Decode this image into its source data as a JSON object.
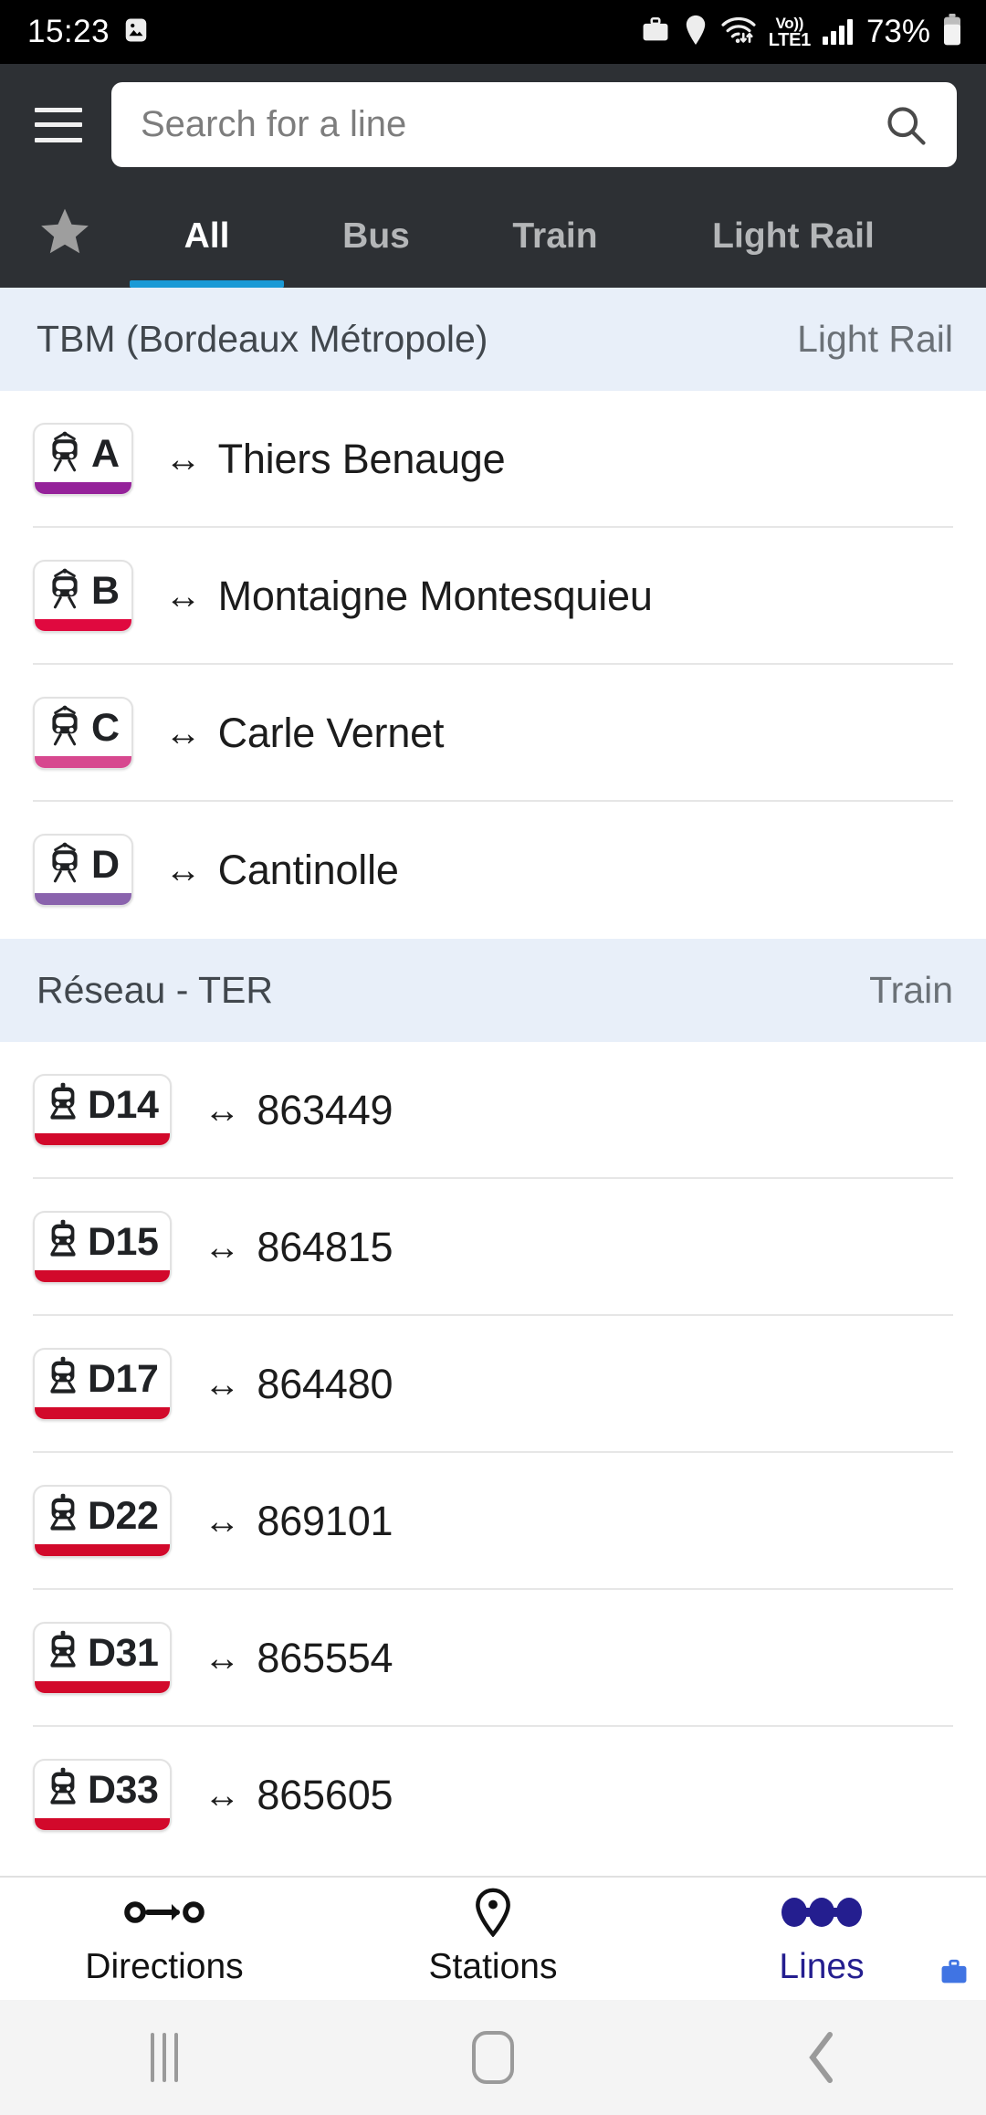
{
  "statusbar": {
    "time": "15:23",
    "icons_left": [
      "photo-icon"
    ],
    "icons_right": [
      "work-briefcase-icon",
      "location-pin-icon",
      "wifi-icon",
      "volte-icon",
      "signal-bars-icon"
    ],
    "volte_top": "Vo))",
    "volte_bottom": "LTE1",
    "battery": "73%"
  },
  "appbar": {
    "menu_icon": "hamburger-menu-icon",
    "search": {
      "placeholder": "Search for a line",
      "value": "",
      "icon": "search-icon"
    },
    "tabs": [
      {
        "label": "",
        "icon": "star-icon",
        "active": false
      },
      {
        "label": "All",
        "active": true
      },
      {
        "label": "Bus",
        "active": false
      },
      {
        "label": "Train",
        "active": false
      },
      {
        "label": "Light Rail",
        "active": false
      }
    ],
    "active_tab_color": "#1b9ad6"
  },
  "groups": [
    {
      "name": "TBM (Bordeaux Métropole)",
      "mode": "Light Rail",
      "rows": [
        {
          "code": "A",
          "icon": "tram-icon",
          "color": "#95229a",
          "arrow": "↔",
          "destination": "Thiers Benauge"
        },
        {
          "code": "B",
          "icon": "tram-icon",
          "color": "#e0093f",
          "arrow": "↔",
          "destination": "Montaigne Montesquieu"
        },
        {
          "code": "C",
          "icon": "tram-icon",
          "color": "#d7488f",
          "arrow": "↔",
          "destination": "Carle Vernet"
        },
        {
          "code": "D",
          "icon": "tram-icon",
          "color": "#8a63ad",
          "arrow": "↔",
          "destination": "Cantinolle"
        }
      ]
    },
    {
      "name": "Réseau - TER",
      "mode": "Train",
      "rows": [
        {
          "code": "D14",
          "icon": "train-icon",
          "color": "#d2092b",
          "arrow": "↔",
          "destination": "863449"
        },
        {
          "code": "D15",
          "icon": "train-icon",
          "color": "#d2092b",
          "arrow": "↔",
          "destination": "864815"
        },
        {
          "code": "D17",
          "icon": "train-icon",
          "color": "#d2092b",
          "arrow": "↔",
          "destination": "864480"
        },
        {
          "code": "D22",
          "icon": "train-icon",
          "color": "#d2092b",
          "arrow": "↔",
          "destination": "869101"
        },
        {
          "code": "D31",
          "icon": "train-icon",
          "color": "#d2092b",
          "arrow": "↔",
          "destination": "865554"
        },
        {
          "code": "D33",
          "icon": "train-icon",
          "color": "#d2092b",
          "arrow": "↔",
          "destination": "865605"
        }
      ]
    }
  ],
  "bottomnav": {
    "active_color": "#241e8f",
    "items": [
      {
        "label": "Directions",
        "icon": "directions-icon",
        "active": false
      },
      {
        "label": "Stations",
        "icon": "location-pin-icon",
        "active": false
      },
      {
        "label": "Lines",
        "icon": "lines-icon",
        "active": true
      }
    ],
    "work_badge_icon": "work-briefcase-icon"
  },
  "androidnav": {
    "recents_icon": "recents-icon",
    "home_icon": "home-icon",
    "back_icon": "back-icon"
  }
}
